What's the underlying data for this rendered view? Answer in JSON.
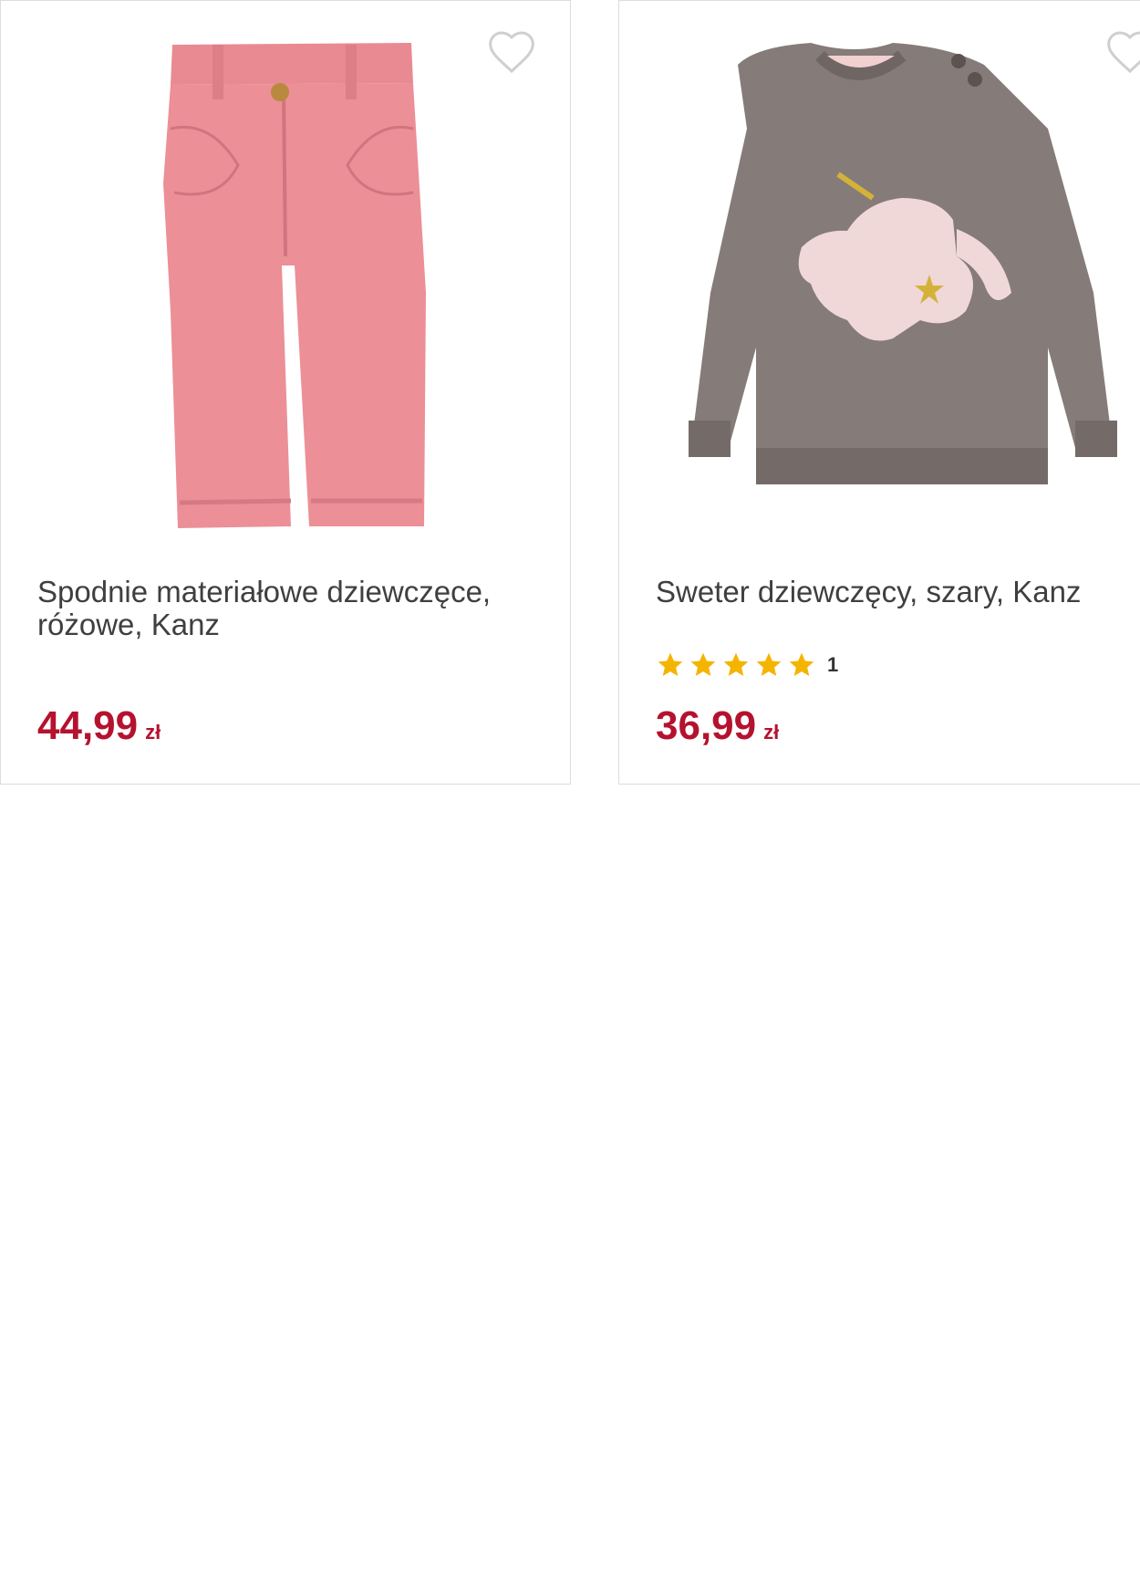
{
  "products": [
    {
      "title": "Spodnie materiałowe dziewczęce, różowe, Kanz",
      "price": "44,99",
      "currency": "zł",
      "image_icon": "pink-corduroy-pants-image",
      "favorite_icon": "heart-outline-icon"
    },
    {
      "title": "Sweter dziewczęcy, szary, Kanz",
      "rating": 5,
      "rating_count": "1",
      "price": "36,99",
      "currency": "zł",
      "image_icon": "grey-unicorn-sweater-image",
      "favorite_icon": "heart-outline-icon"
    }
  ],
  "colors": {
    "price": "#b5122f",
    "star": "#f5b400",
    "border": "#dcdcdc",
    "title": "#3f3f3f"
  }
}
